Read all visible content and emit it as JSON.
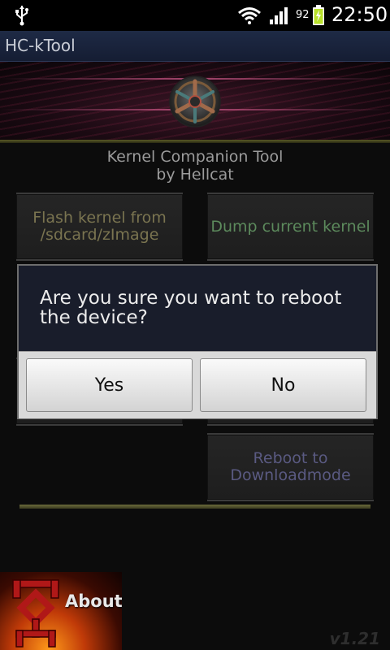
{
  "status_bar": {
    "battery_level": "92",
    "time": "22:50"
  },
  "app": {
    "title": "HC-kTool",
    "heading_line1": "Kernel Companion Tool",
    "heading_line2": "by Hellcat"
  },
  "buttons": {
    "flash_kernel": "Flash kernel from /sdcard/zImage",
    "dump_kernel": "Dump current kernel",
    "reboot_download": "Reboot to Downloadmode"
  },
  "about": {
    "label": "About"
  },
  "version": "v1.21",
  "dialog": {
    "message": "Are you sure you want to reboot the device?",
    "yes_label": "Yes",
    "no_label": "No"
  },
  "colors": {
    "title_bar": "#1e2a45",
    "dialog_bg": "#191d2b",
    "flash_text": "#7a7450",
    "dump_text": "#5c8a5c",
    "download_text": "#5a5a82"
  },
  "icons": [
    "usb-icon",
    "wifi-icon",
    "signal-icon",
    "battery-charging-icon",
    "app-logo-icon",
    "about-logo-icon"
  ]
}
